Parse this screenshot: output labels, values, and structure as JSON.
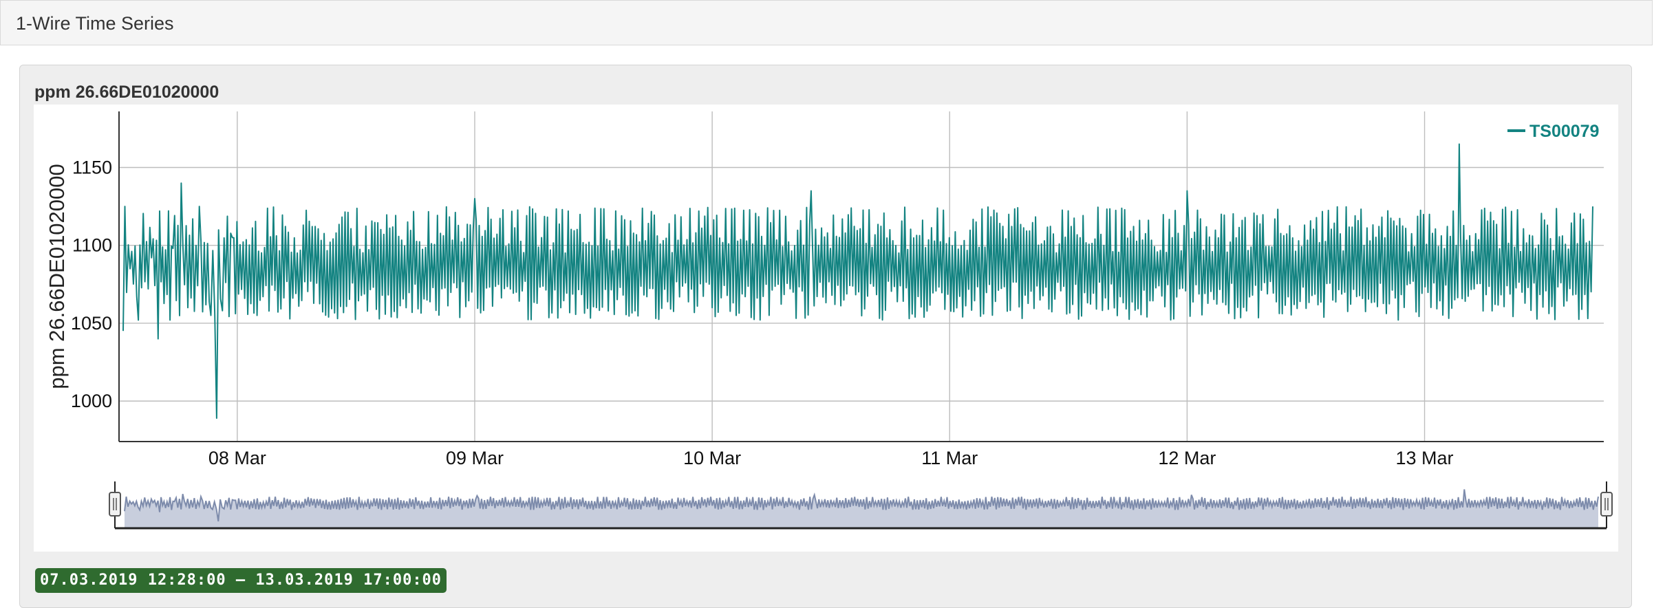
{
  "panel": {
    "title": "1-Wire Time Series"
  },
  "card": {
    "title": "ppm 26.66DE01020000"
  },
  "range_label": "07.03.2019 12:28:00 – 13.03.2019 17:00:00",
  "colors": {
    "series": "#138381",
    "navigator_line": "#7d8bab",
    "navigator_fill": "#c8cedd",
    "badge": "#2f6b2f"
  },
  "chart_data": {
    "type": "line",
    "ylabel": "ppm 26.66DE01020000",
    "xlabel": "",
    "x_start": "2019-03-07T12:28:00",
    "x_end": "2019-03-13T17:00:00",
    "x_ticks": [
      "08 Mar",
      "09 Mar",
      "10 Mar",
      "11 Mar",
      "12 Mar",
      "13 Mar"
    ],
    "x_tick_dates": [
      "2019-03-08T00:00:00",
      "2019-03-09T00:00:00",
      "2019-03-10T00:00:00",
      "2019-03-11T00:00:00",
      "2019-03-12T00:00:00",
      "2019-03-13T00:00:00"
    ],
    "y_ticks": [
      1000,
      1050,
      1100,
      1150
    ],
    "ylim": [
      974,
      1186
    ],
    "grid": true,
    "legend": {
      "position": "top-right"
    },
    "series": [
      {
        "name": "TS00079",
        "approx_range": [
          1052,
          1135
        ],
        "typical_level": 1090,
        "points": [
          [
            "2019-03-07T12:28:00",
            1045
          ],
          [
            "2019-03-07T13:10:00",
            1085
          ],
          [
            "2019-03-07T14:00:00",
            1052
          ],
          [
            "2019-03-07T15:20:00",
            1092
          ],
          [
            "2019-03-07T16:00:00",
            1040
          ],
          [
            "2019-03-07T17:30:00",
            1098
          ],
          [
            "2019-03-07T18:20:00",
            1140
          ],
          [
            "2019-03-07T19:00:00",
            1060
          ],
          [
            "2019-03-07T20:10:00",
            1125
          ],
          [
            "2019-03-07T21:20:00",
            1055
          ],
          [
            "2019-03-07T21:55:00",
            989
          ],
          [
            "2019-03-07T22:30:00",
            1058
          ],
          [
            "2019-03-07T23:30:00",
            1105
          ],
          [
            "2019-03-08T02:00:00",
            1055
          ],
          [
            "2019-03-09T00:00:00",
            1130
          ],
          [
            "2019-03-10T00:00:00",
            1060
          ],
          [
            "2019-03-10T10:00:00",
            1135
          ],
          [
            "2019-03-12T00:00:00",
            1135
          ],
          [
            "2019-03-13T03:30:00",
            1165
          ],
          [
            "2019-03-13T16:30:00",
            1053
          ],
          [
            "2019-03-13T17:00:00",
            1125
          ]
        ]
      }
    ]
  }
}
